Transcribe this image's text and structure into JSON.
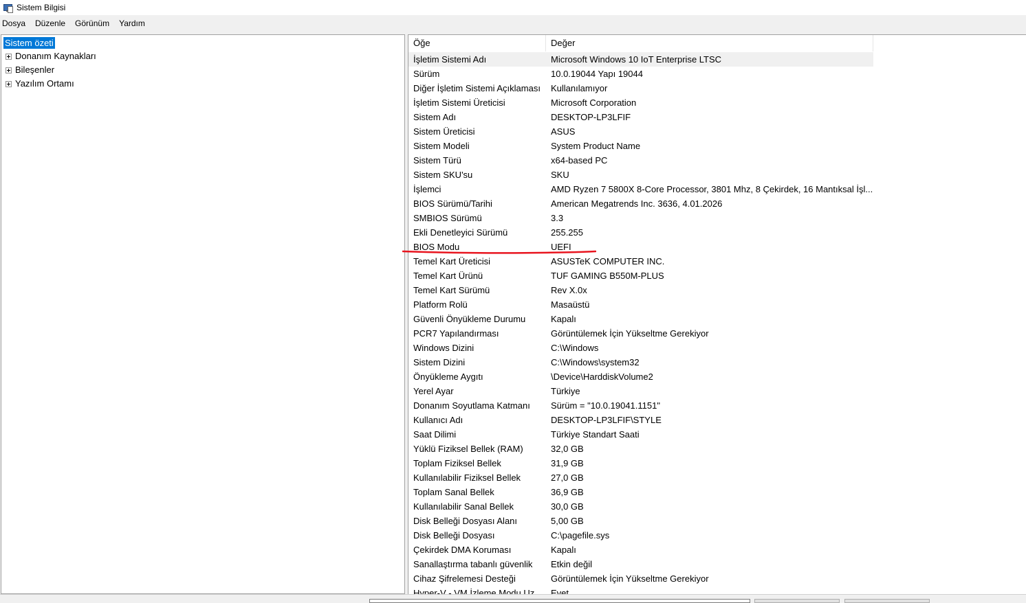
{
  "window": {
    "title": "Sistem Bilgisi",
    "icon": "system-information-icon"
  },
  "menu": [
    "Dosya",
    "Düzenle",
    "Görünüm",
    "Yardım"
  ],
  "tree": {
    "root": "Sistem özeti",
    "children": [
      "Donanım Kaynakları",
      "Bileşenler",
      "Yazılım Ortamı"
    ]
  },
  "table": {
    "headers": [
      "Öğe",
      "Değer"
    ],
    "rows": [
      [
        "İşletim Sistemi Adı",
        "Microsoft Windows 10 IoT Enterprise LTSC"
      ],
      [
        "Sürüm",
        "10.0.19044 Yapı 19044"
      ],
      [
        "Diğer İşletim Sistemi Açıklaması",
        "Kullanılamıyor"
      ],
      [
        "İşletim Sistemi Üreticisi",
        "Microsoft Corporation"
      ],
      [
        "Sistem Adı",
        "DESKTOP-LP3LFIF"
      ],
      [
        "Sistem Üreticisi",
        "ASUS"
      ],
      [
        "Sistem Modeli",
        "System Product Name"
      ],
      [
        "Sistem Türü",
        "x64-based PC"
      ],
      [
        "Sistem SKU'su",
        "SKU"
      ],
      [
        "İşlemci",
        "AMD Ryzen 7 5800X 8-Core Processor, 3801 Mhz, 8 Çekirdek, 16 Mantıksal İşl..."
      ],
      [
        "BIOS Sürümü/Tarihi",
        "American Megatrends Inc. 3636, 4.01.2026"
      ],
      [
        "SMBIOS Sürümü",
        "3.3"
      ],
      [
        "Ekli Denetleyici Sürümü",
        "255.255"
      ],
      [
        "BIOS Modu",
        "UEFI"
      ],
      [
        "Temel Kart Üreticisi",
        "ASUSTeK COMPUTER INC."
      ],
      [
        "Temel Kart Ürünü",
        "TUF GAMING B550M-PLUS"
      ],
      [
        "Temel Kart Sürümü",
        "Rev X.0x"
      ],
      [
        "Platform Rolü",
        "Masaüstü"
      ],
      [
        "Güvenli Önyükleme Durumu",
        "Kapalı"
      ],
      [
        "PCR7 Yapılandırması",
        "Görüntülemek İçin Yükseltme Gerekiyor"
      ],
      [
        "Windows Dizini",
        "C:\\Windows"
      ],
      [
        "Sistem Dizini",
        "C:\\Windows\\system32"
      ],
      [
        "Önyükleme Aygıtı",
        "\\Device\\HarddiskVolume2"
      ],
      [
        "Yerel Ayar",
        "Türkiye"
      ],
      [
        "Donanım Soyutlama Katmanı",
        "Sürüm = \"10.0.19041.1151\""
      ],
      [
        "Kullanıcı Adı",
        "DESKTOP-LP3LFIF\\STYLE"
      ],
      [
        "Saat Dilimi",
        "Türkiye Standart Saati"
      ],
      [
        "Yüklü Fiziksel Bellek (RAM)",
        "32,0 GB"
      ],
      [
        "Toplam Fiziksel Bellek",
        "31,9 GB"
      ],
      [
        "Kullanılabilir Fiziksel Bellek",
        "27,0 GB"
      ],
      [
        "Toplam Sanal Bellek",
        "36,9 GB"
      ],
      [
        "Kullanılabilir Sanal Bellek",
        "30,0 GB"
      ],
      [
        "Disk Belleği Dosyası Alanı",
        "5,00 GB"
      ],
      [
        "Disk Belleği Dosyası",
        "C:\\pagefile.sys"
      ],
      [
        "Çekirdek DMA Koruması",
        "Kapalı"
      ],
      [
        "Sanallaştırma tabanlı güvenlik",
        "Etkin değil"
      ],
      [
        "Cihaz Şifrelemesi Desteği",
        "Görüntülemek İçin Yükseltme Gerekiyor"
      ],
      [
        "Hyper-V - VM İzleme Modu Uz...",
        "Evet"
      ]
    ]
  },
  "colors": {
    "selection": "#0078d7",
    "annotation": "#e8141e",
    "row_highlight": "#f0f0f0"
  }
}
